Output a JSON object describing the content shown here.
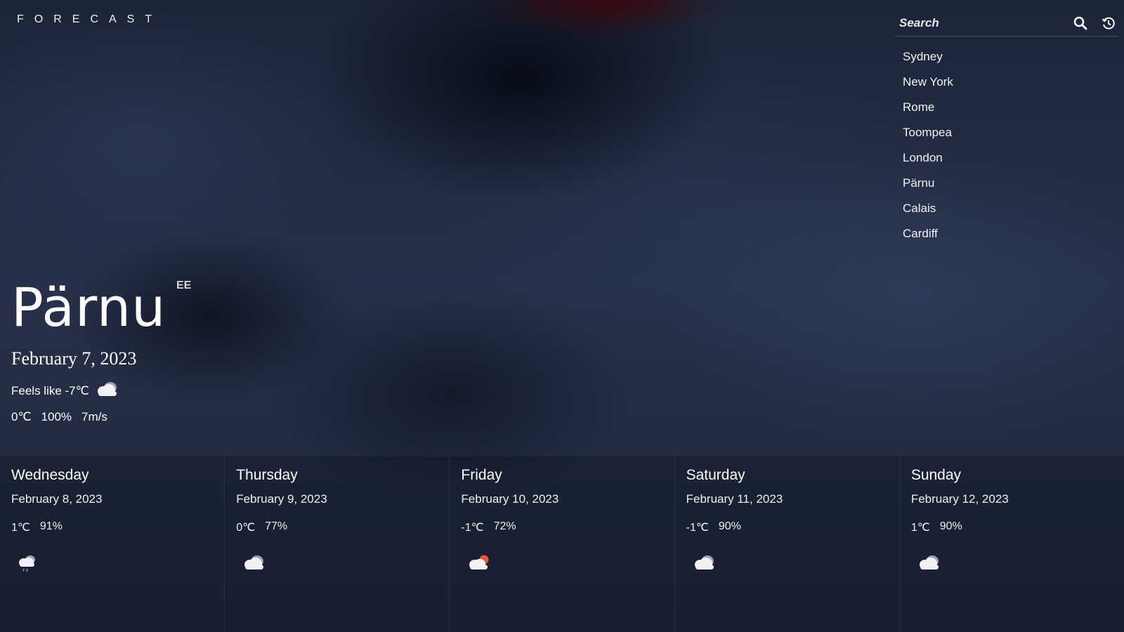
{
  "header": {
    "brand": "FORECAST"
  },
  "search": {
    "placeholder": "Search",
    "search_icon": "search-icon",
    "history_icon": "history-icon"
  },
  "recent_cities": [
    "Sydney",
    "New York",
    "Rome",
    "Toompea",
    "London",
    "Pärnu",
    "Calais",
    "Cardiff"
  ],
  "current": {
    "city": "Pärnu",
    "country": "EE",
    "date": "February 7, 2023",
    "feels_like": "Feels like -7℃",
    "condition_icon": "cloud-icon",
    "temp": "0℃",
    "humidity": "100%",
    "wind": "7m/s"
  },
  "forecast": [
    {
      "day": "Wednesday",
      "date": "February 8, 2023",
      "temp": "1℃",
      "humidity": "91%",
      "icon": "cloud-rain-icon"
    },
    {
      "day": "Thursday",
      "date": "February 9, 2023",
      "temp": "0℃",
      "humidity": "77%",
      "icon": "cloud-icon"
    },
    {
      "day": "Friday",
      "date": "February 10, 2023",
      "temp": "-1℃",
      "humidity": "72%",
      "icon": "cloud-sun-icon"
    },
    {
      "day": "Saturday",
      "date": "February 11, 2023",
      "temp": "-1℃",
      "humidity": "90%",
      "icon": "cloud-icon"
    },
    {
      "day": "Sunday",
      "date": "February 12, 2023",
      "temp": "1℃",
      "humidity": "90%",
      "icon": "cloud-icon"
    }
  ],
  "colors": {
    "text": "#ffffff",
    "sun": "#e8553a",
    "cloud": "#f2f2f2",
    "cloud_shadow": "#9aa3b2"
  }
}
